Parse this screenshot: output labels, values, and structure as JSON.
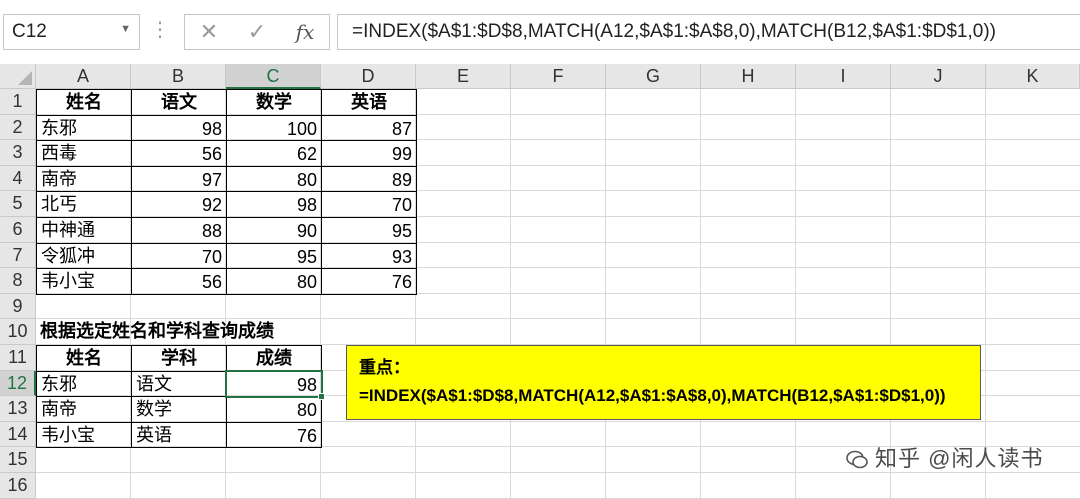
{
  "namebox": "C12",
  "fx_label": "fx",
  "cancel_glyph": "✕",
  "enter_glyph": "✓",
  "formula": "=INDEX($A$1:$D$8,MATCH(A12,$A$1:$A$8,0),MATCH(B12,$A$1:$D$1,0))",
  "columns": [
    "A",
    "B",
    "C",
    "D",
    "E",
    "F",
    "G",
    "H",
    "I",
    "J",
    "K"
  ],
  "rows": [
    "1",
    "2",
    "3",
    "4",
    "5",
    "6",
    "7",
    "8",
    "9",
    "10",
    "11",
    "12",
    "13",
    "14",
    "15",
    "16"
  ],
  "table1": {
    "headers": [
      "姓名",
      "语文",
      "数学",
      "英语"
    ],
    "rows": [
      [
        "东邪",
        "98",
        "100",
        "87"
      ],
      [
        "西毒",
        "56",
        "62",
        "99"
      ],
      [
        "南帝",
        "97",
        "80",
        "89"
      ],
      [
        "北丐",
        "92",
        "98",
        "70"
      ],
      [
        "中神通",
        "88",
        "90",
        "95"
      ],
      [
        "令狐冲",
        "70",
        "95",
        "93"
      ],
      [
        "韦小宝",
        "56",
        "80",
        "76"
      ]
    ]
  },
  "query_title": "根据选定姓名和学科查询成绩",
  "table2": {
    "headers": [
      "姓名",
      "学科",
      "成绩"
    ],
    "rows": [
      [
        "东邪",
        "语文",
        "98"
      ],
      [
        "南帝",
        "数学",
        "80"
      ],
      [
        "韦小宝",
        "英语",
        "76"
      ]
    ]
  },
  "note": {
    "title": "重点：",
    "formula": "=INDEX($A$1:$D$8,MATCH(A12,$A$1:$A$8,0),MATCH(B12,$A$1:$D$1,0))"
  },
  "watermark": "知乎 @闲人读书"
}
